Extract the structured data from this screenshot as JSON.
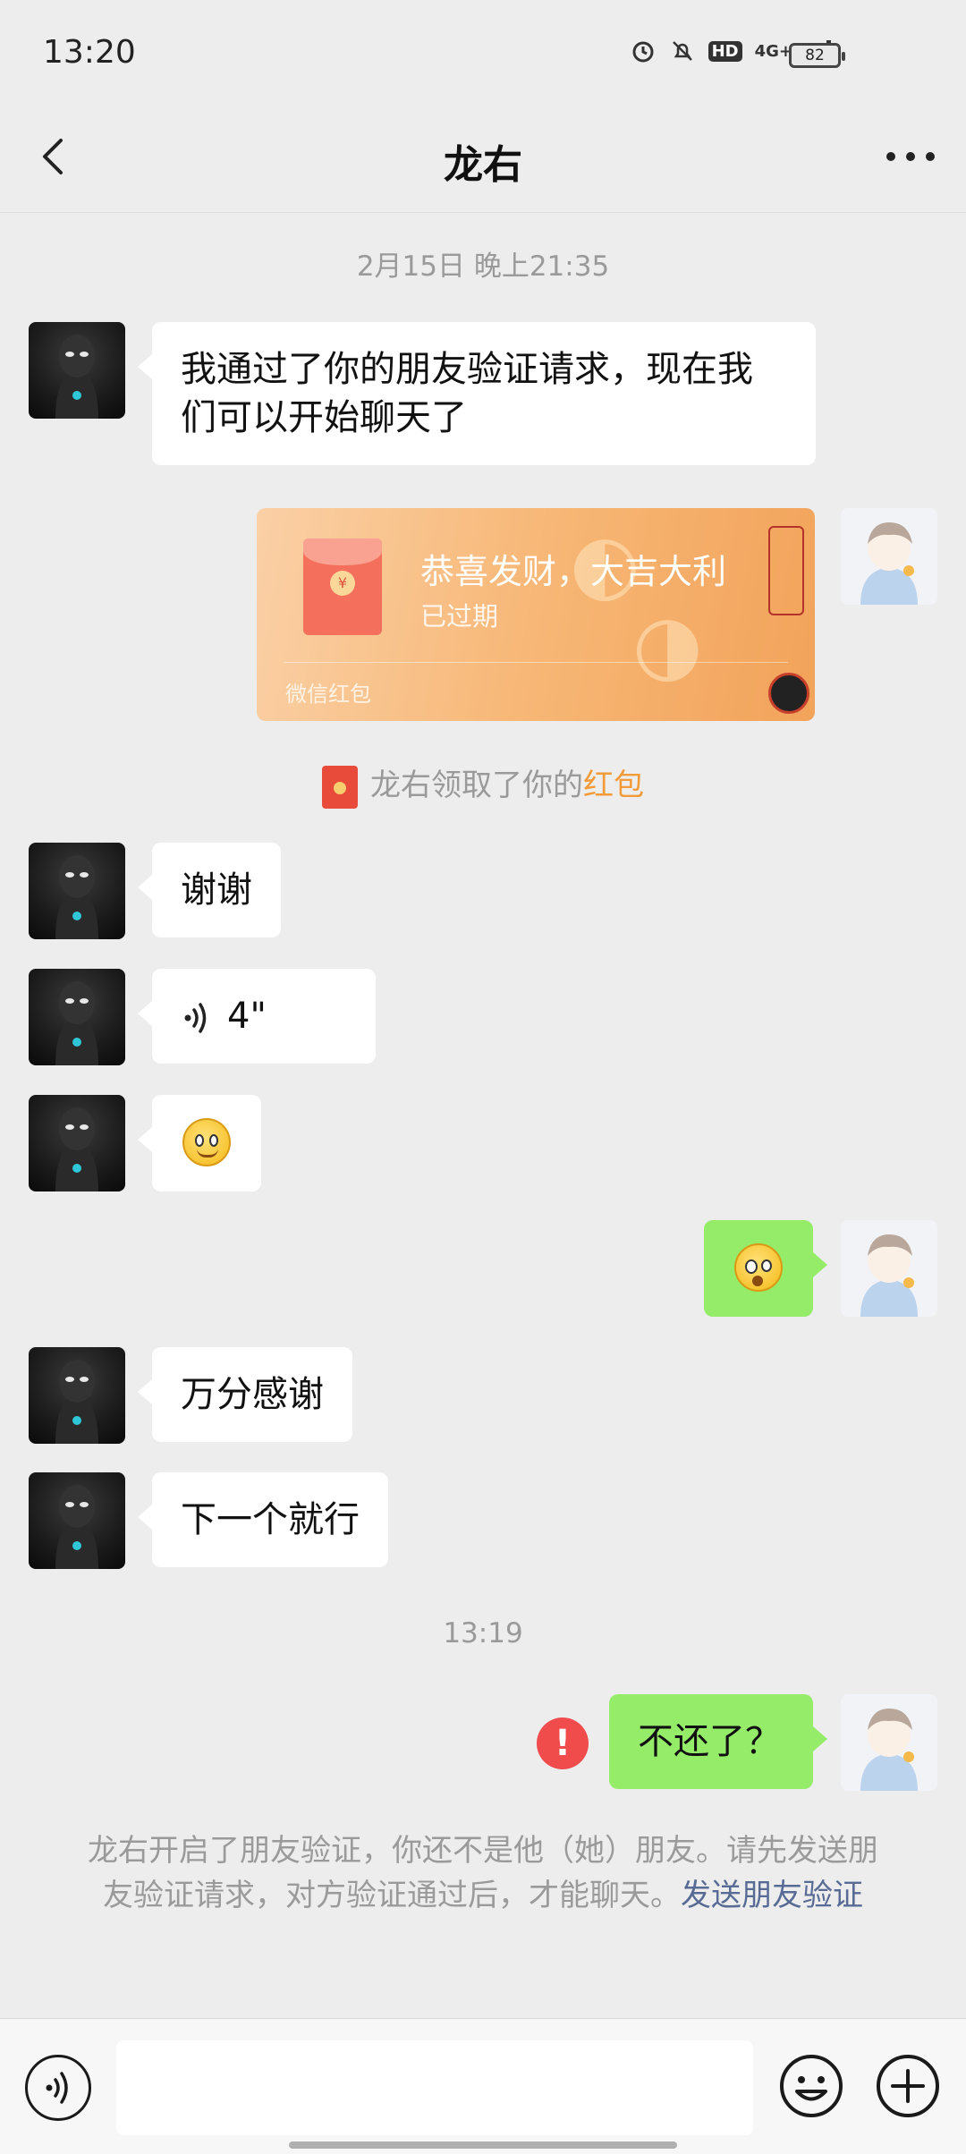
{
  "status_bar": {
    "time": "13:20",
    "network": "4G+",
    "hd": "HD",
    "battery": "82"
  },
  "nav": {
    "title": "龙右"
  },
  "timestamps": {
    "first": "2月15日 晚上21:35",
    "second": "13:19"
  },
  "messages": [
    {
      "side": "left",
      "text": "我通过了你的朋友验证请求，现在我们可以开始聊天了"
    },
    {
      "side": "right",
      "type": "red_packet",
      "title": "恭喜发财，大吉大利",
      "status": "已过期",
      "footer": "微信红包"
    },
    {
      "side": "left",
      "text": "谢谢"
    },
    {
      "side": "left",
      "type": "voice",
      "duration": "4\""
    },
    {
      "side": "left",
      "type": "emoji"
    },
    {
      "side": "right",
      "type": "emoji"
    },
    {
      "side": "left",
      "text": "万分感谢"
    },
    {
      "side": "left",
      "text": "下一个就行"
    },
    {
      "side": "right",
      "text": "不还了？",
      "failed": true
    }
  ],
  "system_notice": {
    "red_packet_received_prefix": "龙右领取了你的",
    "red_packet_received_link": "红包",
    "verify_text": "龙右开启了朋友验证，你还不是他（她）朋友。请先发送朋友验证请求，对方验证通过后，才能聊天。",
    "verify_link": "发送朋友验证"
  },
  "colors": {
    "bubble_self": "#95ec69",
    "link_blue": "#576b95",
    "link_orange": "#f29b38",
    "error_red": "#f04c4c"
  }
}
